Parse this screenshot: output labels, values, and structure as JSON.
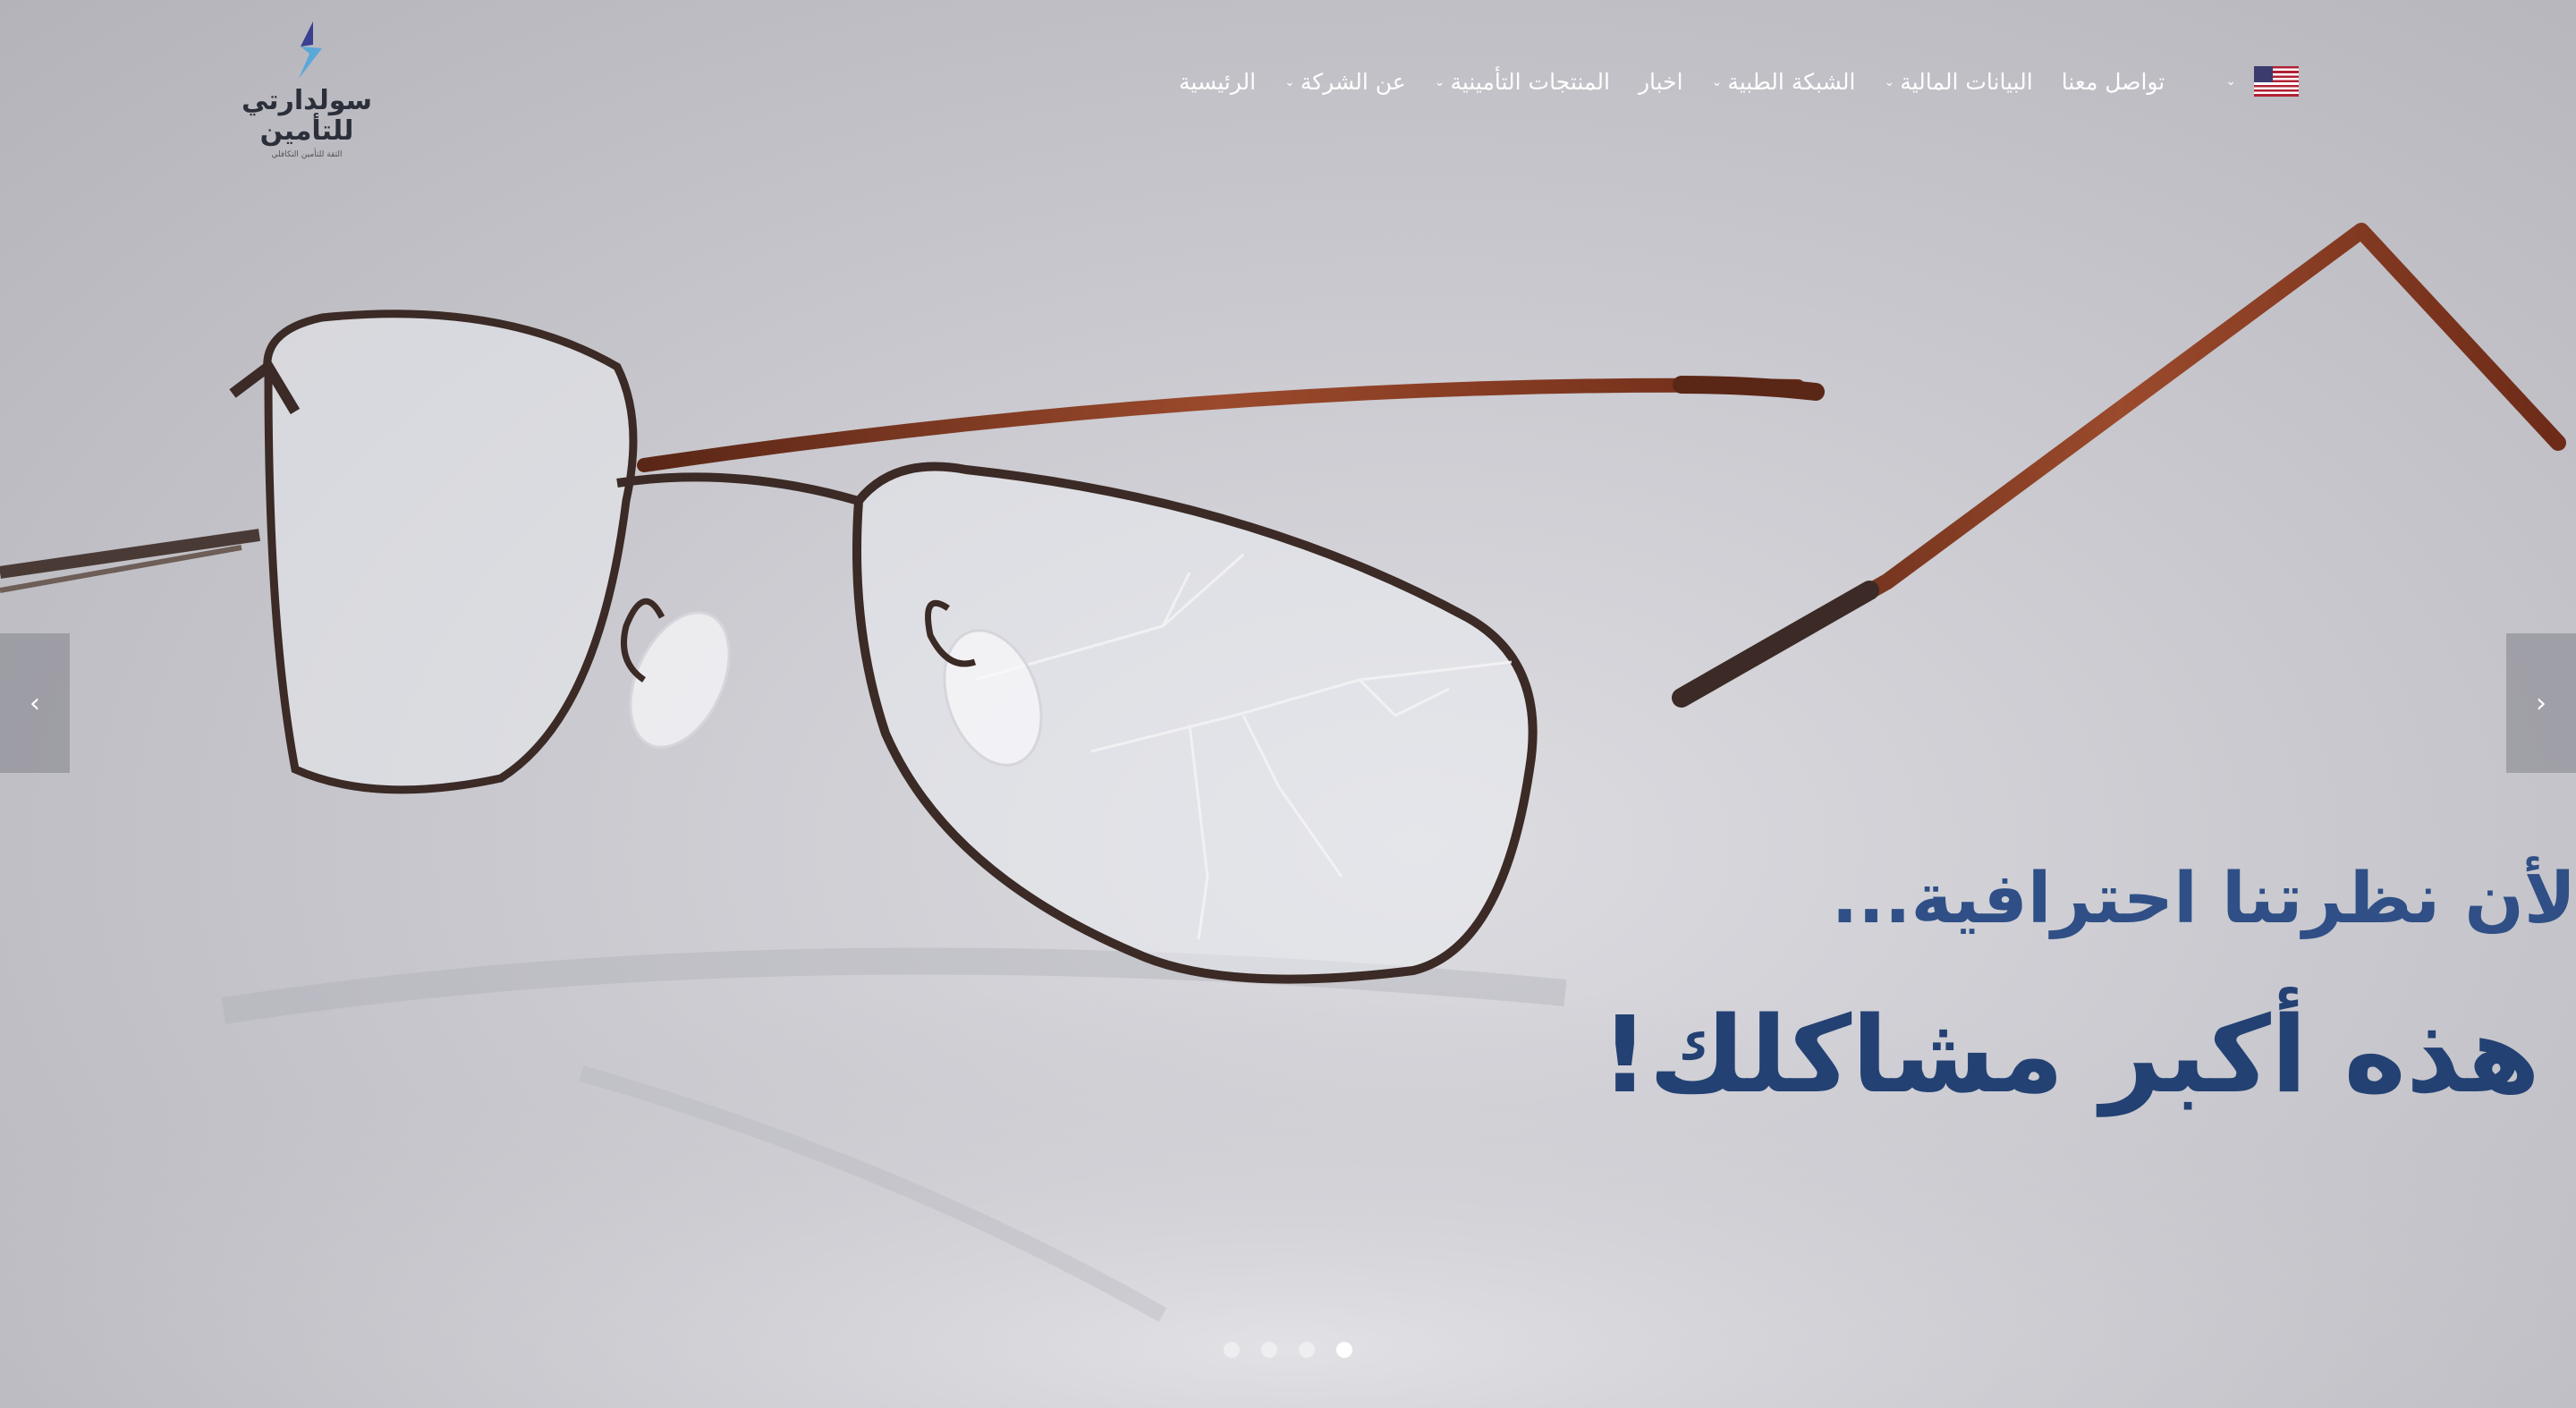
{
  "logo": {
    "name_line1": "سولدارتي",
    "name_line2": "للتأمين",
    "tagline": "الثقة للتأمين التكافلي"
  },
  "nav": {
    "items": [
      {
        "label": "الرئيسية",
        "dropdown": false
      },
      {
        "label": "عن الشركة",
        "dropdown": true
      },
      {
        "label": "المنتجات التأمينية",
        "dropdown": true
      },
      {
        "label": "اخبار",
        "dropdown": false
      },
      {
        "label": "الشبكة الطبية",
        "dropdown": true
      },
      {
        "label": "البيانات المالية",
        "dropdown": true
      },
      {
        "label": "تواصل معنا",
        "dropdown": false
      }
    ],
    "language_flag": "us-flag-icon",
    "caret_symbol": "⌄"
  },
  "slider": {
    "prev_symbol": "‹",
    "next_symbol": "›",
    "headline_line1": "لأن نظرتنا احترافية...",
    "headline_line2": "هذه أكبر مشاكلك!",
    "slide_count": 4,
    "active_slide": 4
  },
  "colors": {
    "headline_primary": "#234173",
    "headline_secondary": "#2f4f86",
    "frame": "#3b2a25",
    "temple": "#7a3520"
  }
}
